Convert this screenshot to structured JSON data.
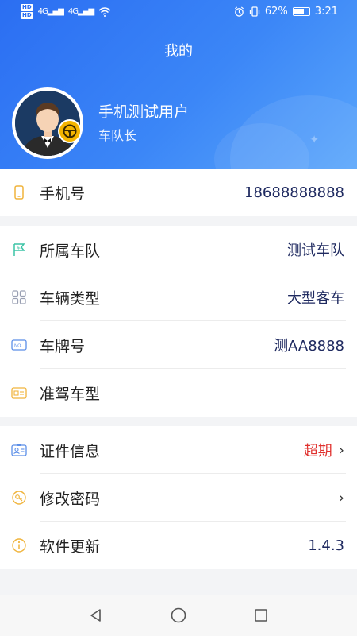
{
  "status_bar": {
    "network": "4G",
    "battery": "62%",
    "time": "3:21"
  },
  "header": {
    "title": "我的",
    "user_name": "手机测试用户",
    "user_role": "车队长"
  },
  "phone_section": {
    "label": "手机号",
    "value": "18688888888"
  },
  "vehicle_section": [
    {
      "label": "所属车队",
      "value": "测试车队"
    },
    {
      "label": "车辆类型",
      "value": "大型客车"
    },
    {
      "label": "车牌号",
      "value": "测AA8888"
    },
    {
      "label": "准驾车型",
      "value": ""
    }
  ],
  "settings_section": [
    {
      "label": "证件信息",
      "value": "超期"
    },
    {
      "label": "修改密码",
      "value": ""
    },
    {
      "label": "软件更新",
      "value": "1.4.3"
    }
  ],
  "colors": {
    "header_start": "#2b6ef2",
    "header_end": "#5aa6fb",
    "value_text": "#1f2a60",
    "warning": "#e0312e",
    "badge": "#f4b400"
  },
  "icons": [
    "phone-icon",
    "flag-icon",
    "grid-icon",
    "plate-icon",
    "license-icon",
    "id-card-icon",
    "key-icon",
    "info-icon"
  ]
}
